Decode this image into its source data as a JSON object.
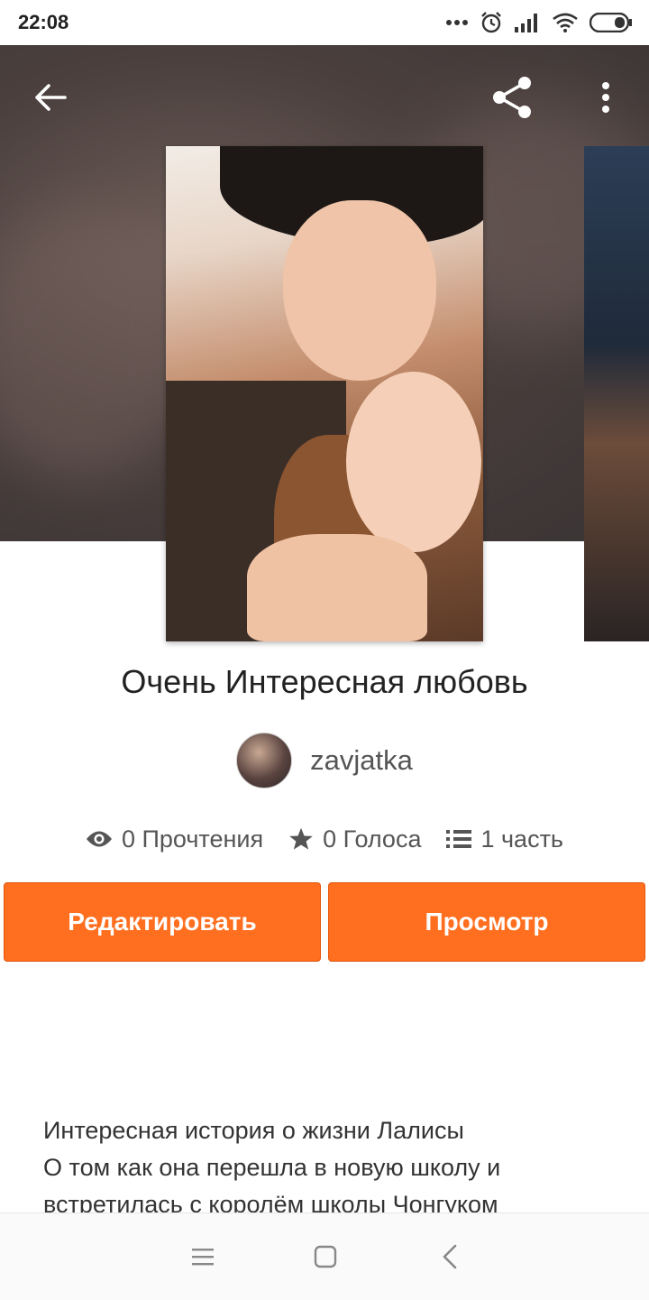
{
  "status_bar": {
    "time": "22:08",
    "icons": [
      "more-dots-icon",
      "alarm-icon",
      "signal-icon",
      "wifi-icon",
      "battery-icon"
    ]
  },
  "header": {
    "back_icon": "arrow-left-icon",
    "share_icon": "share-icon",
    "menu_icon": "more-vertical-icon"
  },
  "story": {
    "title": "Очень Интересная любовь",
    "author": "zavjatka",
    "stats": {
      "reads": "0 Прочтения",
      "votes": "0 Голоса",
      "parts": "1 часть"
    },
    "description": "Интересная история о жизни Лалисы\nО том как она перешла в новую школу и\nвстретилась с королём школы Чонгуком"
  },
  "actions": {
    "edit_label": "Редактировать",
    "view_label": "Просмотр"
  },
  "colors": {
    "accent": "#ff6f1f",
    "text_primary": "#222222",
    "text_secondary": "#555555"
  },
  "nav": {
    "icons": [
      "menu-icon",
      "home-square-icon",
      "back-chevron-icon"
    ]
  }
}
